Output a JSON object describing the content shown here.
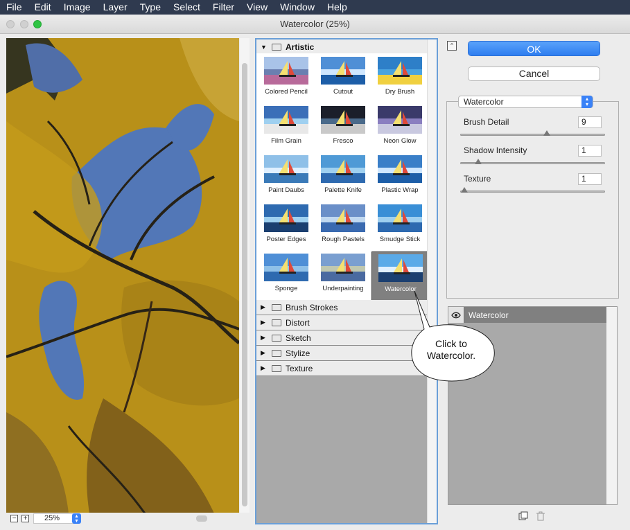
{
  "menubar": {
    "items": [
      "File",
      "Edit",
      "Image",
      "Layer",
      "Type",
      "Select",
      "Filter",
      "View",
      "Window",
      "Help"
    ]
  },
  "window": {
    "title": "Watercolor (25%)"
  },
  "preview": {
    "zoom": "25%"
  },
  "gallery": {
    "open_folder": "Artistic",
    "filters": [
      "Colored Pencil",
      "Cutout",
      "Dry Brush",
      "Film Grain",
      "Fresco",
      "Neon Glow",
      "Paint Daubs",
      "Palette Knife",
      "Plastic Wrap",
      "Poster Edges",
      "Rough Pastels",
      "Smudge Stick",
      "Sponge",
      "Underpainting",
      "Watercolor"
    ],
    "selected_filter": "Watercolor",
    "folders": [
      "Brush Strokes",
      "Distort",
      "Sketch",
      "Stylize",
      "Texture"
    ]
  },
  "buttons": {
    "ok": "OK",
    "cancel": "Cancel"
  },
  "settings": {
    "filter_select": "Watercolor",
    "params": [
      {
        "label": "Brush Detail",
        "value": "9",
        "fraction": 0.6
      },
      {
        "label": "Shadow Intensity",
        "value": "1",
        "fraction": 0.1
      },
      {
        "label": "Texture",
        "value": "1",
        "fraction": 0.0
      }
    ]
  },
  "layers": {
    "items": [
      {
        "name": "Watercolor"
      }
    ]
  },
  "callout": {
    "text_line1": "Click to",
    "text_line2": "Watercolor."
  },
  "colors": {
    "accent": "#2e7ef0",
    "menubar": "#2f3a4f",
    "selected_thumb": "#808080"
  },
  "icons": [
    "expand-collapse-icon",
    "eye-icon",
    "new-layer-icon",
    "trash-icon",
    "folder-icon",
    "disclosure-triangle-icon"
  ]
}
